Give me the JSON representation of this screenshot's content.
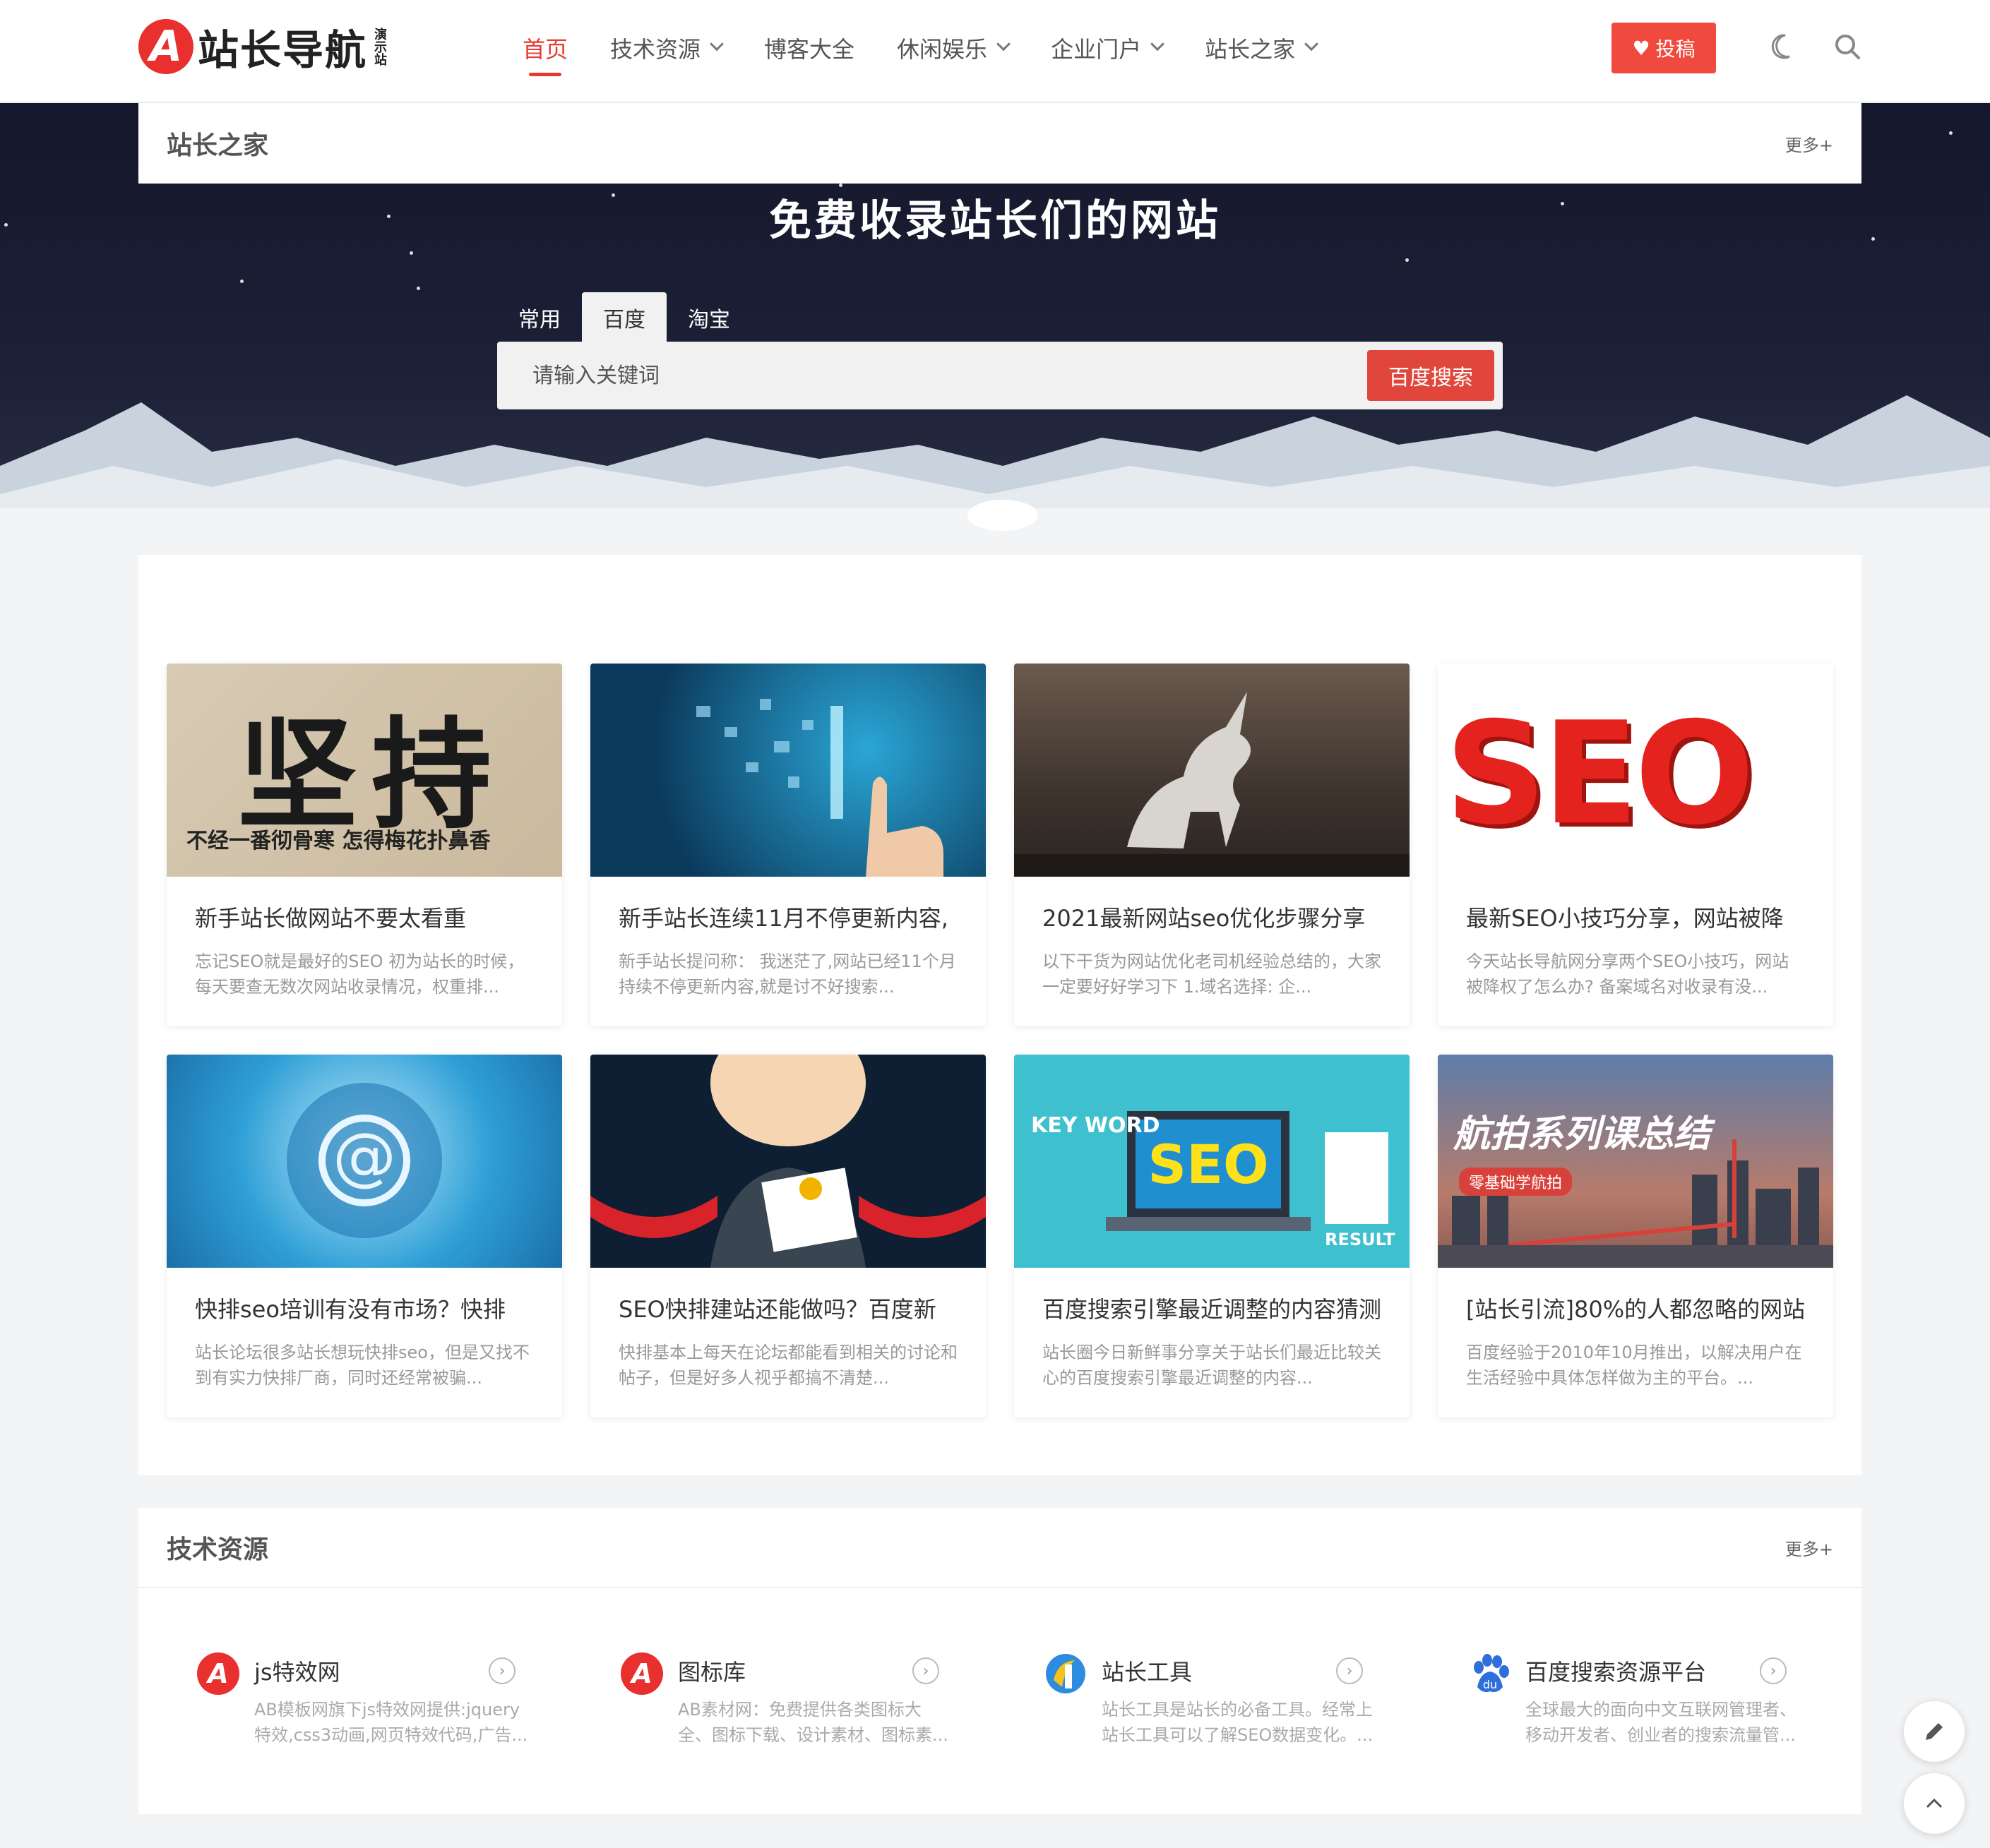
{
  "brand": {
    "badge": "A",
    "name": "站长导航",
    "sub": "演示站"
  },
  "nav": {
    "items": [
      {
        "label": "首页",
        "active": true,
        "dropdown": false
      },
      {
        "label": "技术资源",
        "active": false,
        "dropdown": true
      },
      {
        "label": "博客大全",
        "active": false,
        "dropdown": false
      },
      {
        "label": "休闲娱乐",
        "active": false,
        "dropdown": true
      },
      {
        "label": "企业门户",
        "active": false,
        "dropdown": true
      },
      {
        "label": "站长之家",
        "active": false,
        "dropdown": true
      }
    ],
    "submit_label": "投稿"
  },
  "hero": {
    "section_title": "站长之家",
    "more": "更多+",
    "title": "免费收录站长们的网站",
    "tabs": [
      "常用",
      "百度",
      "淘宝"
    ],
    "active_tab": 1,
    "search_placeholder": "请输入关键词",
    "search_button": "百度搜索"
  },
  "articles": [
    {
      "title": "新手站长做网站不要太看重",
      "desc": "忘记SEO就是最好的SEO 初为站长的时候，每天要查无数次网站收录情况，权重排...",
      "img_text": "坚持",
      "img_sub": "不经一番彻骨寒 怎得梅花扑鼻香"
    },
    {
      "title": "新手站长连续11月不停更新内容,",
      "desc": "新手站长提问称： 我迷茫了,网站已经11个月持续不停更新内容,就是讨不好搜索..."
    },
    {
      "title": "2021最新网站seo优化步骤分享",
      "desc": "以下干货为网站优化老司机经验总结的，大家一定要好好学习下 1.域名选择: 企..."
    },
    {
      "title": "最新SEO小技巧分享，网站被降",
      "desc": "今天站长导航网分享两个SEO小技巧，网站被降权了怎么办? 备案域名对收录有没...",
      "img_text": "SEO"
    },
    {
      "title": "快排seo培训有没有市场？快排",
      "desc": "站长论坛很多站长想玩快排seo，但是又找不到有实力快排厂商，同时还经常被骗..."
    },
    {
      "title": "SEO快排建站还能做吗？百度新",
      "desc": "快排基本上每天在论坛都能看到相关的讨论和帖子，但是好多人视乎都搞不清楚..."
    },
    {
      "title": "百度搜索引擎最近调整的内容猜测",
      "desc": "站长圈今日新鲜事分享关于站长们最近比较关心的百度搜索引擎最近调整的内容...",
      "img_text": "SEO",
      "img_key": "KEY WORD",
      "img_result": "RESULT"
    },
    {
      "title": "[站长引流]80%的人都忽略的网站",
      "desc": "百度经验于2010年10月推出，以解决用户在生活经验中具体怎样做为主的平台。...",
      "img_text": "航拍系列课总结",
      "img_sub": "零基础学航拍"
    }
  ],
  "resources": {
    "title": "技术资源",
    "more": "更多+",
    "items": [
      {
        "name": "js特效网",
        "desc": "AB模板网旗下js特效网提供:jquery特效,css3动画,网页特效代码,广告...",
        "icon": "a-logo-icon"
      },
      {
        "name": "图标库",
        "desc": "AB素材网：免费提供各类图标大全、图标下载、设计素材、图标素...",
        "icon": "a-logo-icon"
      },
      {
        "name": "站长工具",
        "desc": "站长工具是站长的必备工具。经常上站长工具可以了解SEO数据变化。...",
        "icon": "chinaz-icon"
      },
      {
        "name": "百度搜索资源平台",
        "desc": "全球最大的面向中文互联网管理者、移动开发者、创业者的搜索流量管...",
        "icon": "baidu-paw-icon"
      }
    ]
  },
  "colors": {
    "accent": "#e8392f",
    "button": "#f04a3e"
  }
}
